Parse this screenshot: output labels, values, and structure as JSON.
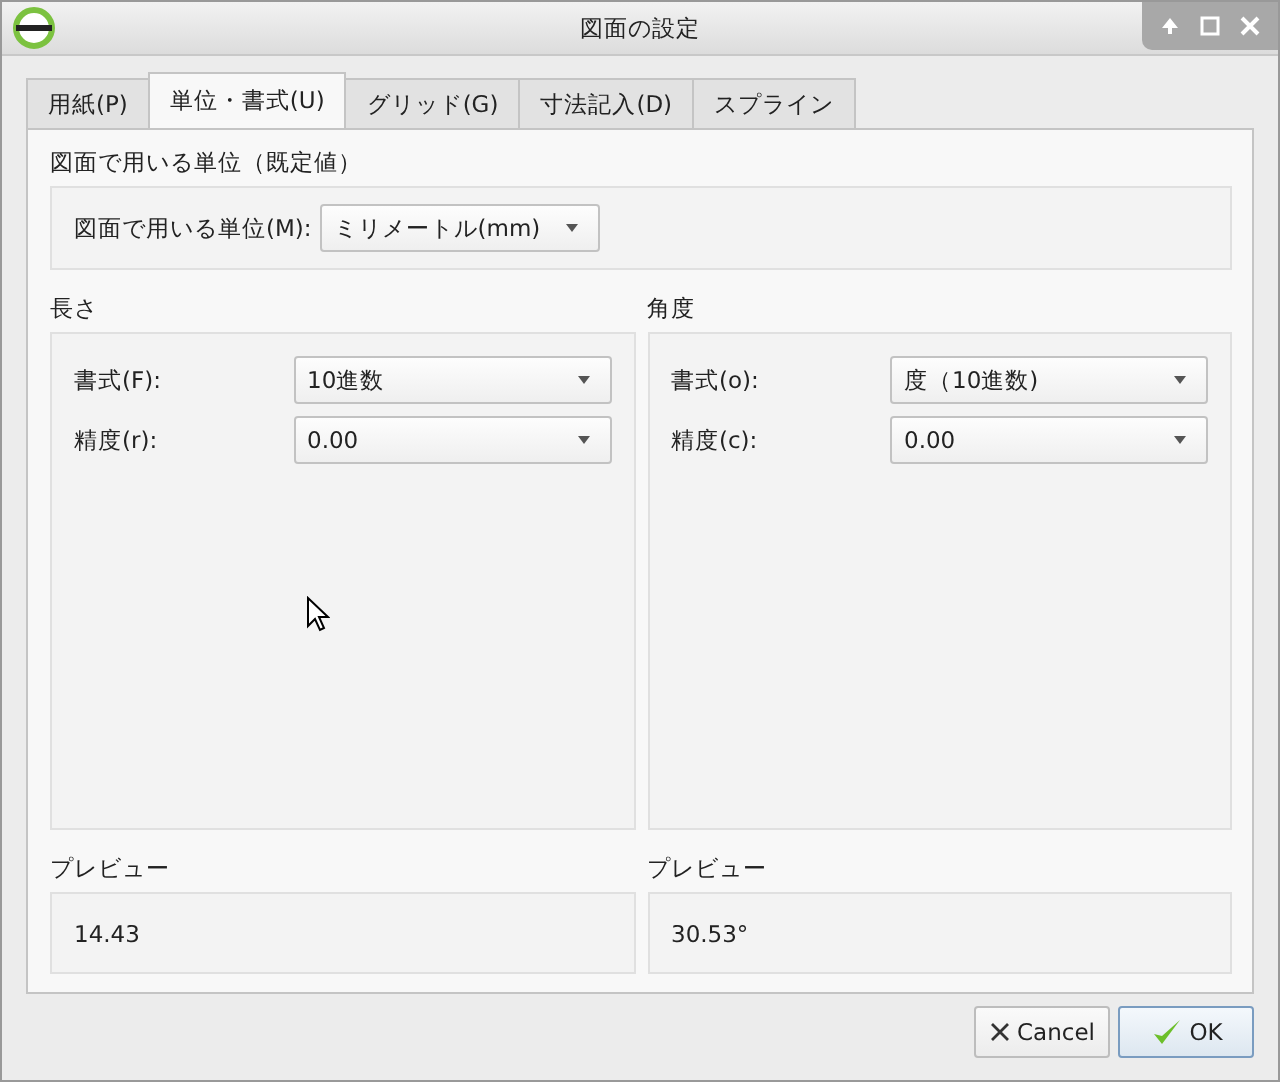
{
  "window": {
    "title": "図面の設定"
  },
  "tabs": [
    {
      "label": "用紙(P)",
      "selected": false
    },
    {
      "label": "単位・書式(U)",
      "selected": true
    },
    {
      "label": "グリッド(G)",
      "selected": false
    },
    {
      "label": "寸法記入(D)",
      "selected": false
    },
    {
      "label": "スプライン",
      "selected": false
    }
  ],
  "units": {
    "heading": "図面で用いる単位（既定値）",
    "label": "図面で用いる単位(M):",
    "value": "ミリメートル(mm)"
  },
  "length": {
    "heading": "長さ",
    "fields": [
      {
        "label": "書式(F):",
        "value": "10進数"
      },
      {
        "label": "精度(r):",
        "value": "0.00"
      }
    ],
    "preview_heading": "プレビュー",
    "preview": "14.43"
  },
  "angle": {
    "heading": "角度",
    "fields": [
      {
        "label": "書式(o):",
        "value": "度（10進数)"
      },
      {
        "label": "精度(c):",
        "value": "0.00"
      }
    ],
    "preview_heading": "プレビュー",
    "preview": "30.53°"
  },
  "buttons": [
    {
      "label": "Cancel",
      "kind": "cancel"
    },
    {
      "label": "OK",
      "kind": "ok"
    }
  ]
}
